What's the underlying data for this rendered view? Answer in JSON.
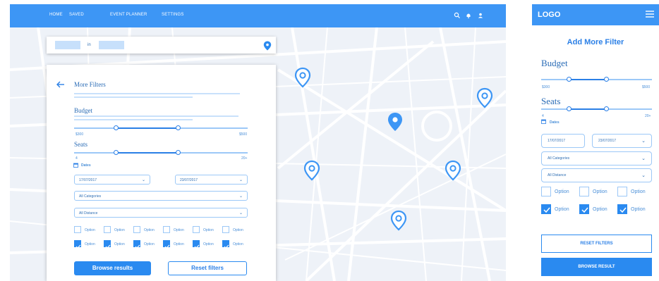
{
  "colors": {
    "primary": "#3d96f5",
    "accent": "#2a8af0",
    "light": "#c9e1fb",
    "map_bg": "#eef2f8"
  },
  "desktop": {
    "nav": [
      "HOME",
      "SAVED",
      "EVENT PLANNER",
      "SETTINGS"
    ],
    "top_icons": [
      "search-icon",
      "bell-icon",
      "user-icon"
    ],
    "search": {
      "connector": "in",
      "pin_icon": "location-pin-icon"
    },
    "filters": {
      "back_icon": "back-arrow-icon",
      "title": "More Filters",
      "budget": {
        "heading": "Budget",
        "min": "$300",
        "max": "$500"
      },
      "seats": {
        "heading": "Seats",
        "min": "4",
        "max": "20+"
      },
      "dates": {
        "label": "Dates",
        "icon": "calendar-icon",
        "from": "17/07/2017",
        "to": "23/07/2017"
      },
      "categories": "All Categories",
      "distance": "All Distance",
      "options_row1": [
        "Option",
        "Option",
        "Option",
        "Option",
        "Option",
        "Option"
      ],
      "options_row2": [
        "Option",
        "Option",
        "Option",
        "Option",
        "Option",
        "Option"
      ],
      "browse_label": "Browse results",
      "reset_label": "Reset filters"
    }
  },
  "mobile": {
    "logo": "LOGO",
    "menu_icon": "hamburger-menu-icon",
    "title": "Add More Filter",
    "budget": {
      "heading": "Budget",
      "min": "$300",
      "max": "$500"
    },
    "seats": {
      "heading": "Seats",
      "min": "4",
      "max": "20+"
    },
    "dates": {
      "label": "Dates",
      "from": "17/07/2017",
      "to": "23/07/2017"
    },
    "categories": "All Categories",
    "distance": "All Distance",
    "options_row1": [
      "Option",
      "Option",
      "Option"
    ],
    "options_row2": [
      "Option",
      "Option",
      "Option"
    ],
    "reset_label": "RESET FILTERS",
    "browse_label": "BROWSE RESULT"
  }
}
